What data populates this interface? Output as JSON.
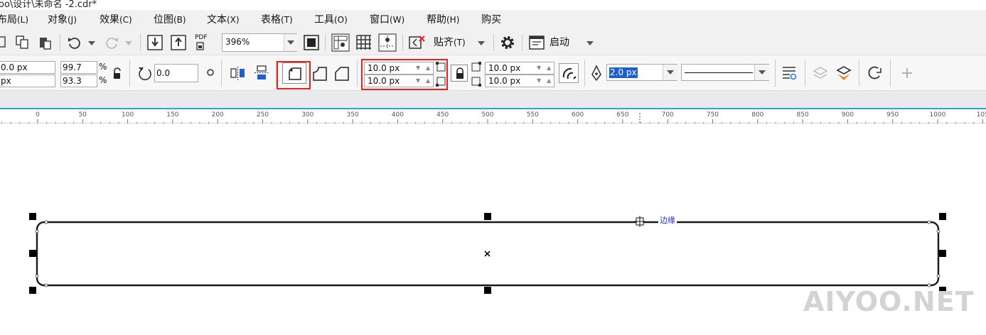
{
  "window": {
    "title": "oo\\设计\\未命名 -2.cdr*"
  },
  "menu": {
    "items": [
      {
        "label": "布局",
        "key": "(L)"
      },
      {
        "label": "对象",
        "key": "(J)"
      },
      {
        "label": "效果",
        "key": "(C)"
      },
      {
        "label": "位图",
        "key": "(B)"
      },
      {
        "label": "文本",
        "key": "(X)"
      },
      {
        "label": "表格",
        "key": "(T)"
      },
      {
        "label": "工具",
        "key": "(O)"
      },
      {
        "label": "窗口",
        "key": "(W)"
      },
      {
        "label": "帮助",
        "key": "(H)"
      },
      {
        "label": "购买",
        "key": ""
      }
    ]
  },
  "toolbar": {
    "pdf_label": "PDF",
    "zoom_value": "396%",
    "snap_label": "贴齐",
    "snap_key": "(T)",
    "launch_label": "启动"
  },
  "props": {
    "pos_x": "0.0 px",
    "pos_y": "px",
    "scale_x": "99.7",
    "scale_y": "93.3",
    "percent": "%",
    "rotation": "0.0",
    "corner_top_left": "10.0 px",
    "corner_bottom_left": "10.0 px",
    "corner_top_right": "10.0 px",
    "corner_bottom_right": "10.0 px",
    "outline_width": "2.0 px"
  },
  "ruler": {
    "labels": [
      "0",
      "50",
      "100",
      "150",
      "200",
      "250",
      "300",
      "350",
      "400",
      "450",
      "500",
      "550",
      "600",
      "650",
      "700",
      "750",
      "800",
      "850",
      "900",
      "950",
      "1000",
      "105"
    ]
  },
  "canvas": {
    "edge_label": "边缘",
    "watermark": "AIYOO.NET"
  },
  "colors": {
    "highlight_box": "#e8231f",
    "selection_blue": "#1e5fcf",
    "ruler_accent": "#2ea3d6"
  }
}
